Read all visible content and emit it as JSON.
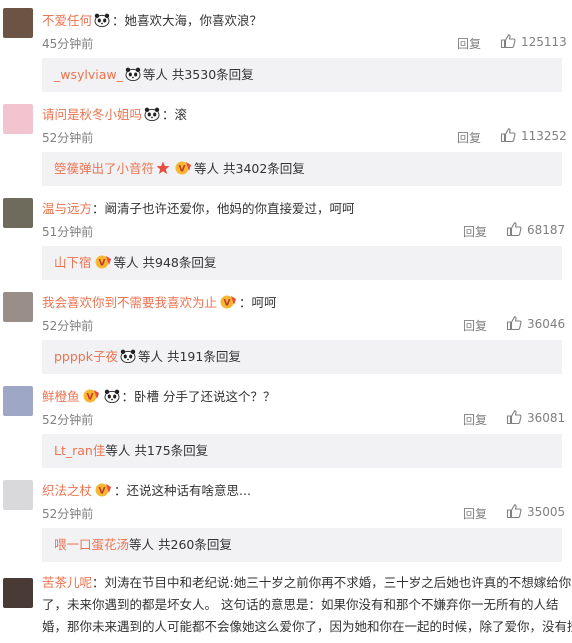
{
  "comments": [
    {
      "user": "不爱任何",
      "text": "：她喜欢大海，你喜欢浪？",
      "time": "45分钟前",
      "reply_label": "回复",
      "likes": "125113",
      "avatar_color": "#6b5444",
      "reply_summary": {
        "name": "_wsylviaw_",
        "text": "等人 共3530条回复"
      }
    },
    {
      "user": "请问是秋冬小姐吗",
      "text": "：滚",
      "time": "52分钟前",
      "reply_label": "回复",
      "likes": "113252",
      "avatar_color": "#f2c4cf",
      "reply_summary": {
        "name": "箜篌弹出了小音符",
        "text": "等人 共3402条回复"
      }
    },
    {
      "user": "温与远方",
      "text": "：阚清子也许还爱你，他妈的你直接爱过，呵呵",
      "time": "51分钟前",
      "reply_label": "回复",
      "likes": "68187",
      "avatar_color": "#6e6a5c",
      "reply_summary": {
        "name": "山下宿",
        "text": "等人 共948条回复"
      }
    },
    {
      "user": "我会喜欢你到不需要我喜欢为止",
      "text": "：呵呵",
      "time": "52分钟前",
      "reply_label": "回复",
      "likes": "36046",
      "avatar_color": "#9a8f88",
      "reply_summary": {
        "name": "ppppk子夜",
        "text": "等人 共191条回复"
      }
    },
    {
      "user": "鲜橙鱼",
      "text": "：卧槽 分手了还说这个？？",
      "time": "52分钟前",
      "reply_label": "回复",
      "likes": "36081",
      "avatar_color": "#9fa7c6",
      "reply_summary": {
        "name": "Lt_ran佳",
        "text": "等人 共175条回复"
      }
    },
    {
      "user": "织法之杖",
      "text": "：还说这种话有啥意思...",
      "time": "52分钟前",
      "reply_label": "回复",
      "likes": "35005",
      "avatar_color": "#d9d9dc",
      "reply_summary": {
        "name": "喂一口蛋花汤",
        "text": "等人 共260条回复"
      }
    }
  ],
  "last_comment": {
    "user": "苦茶儿呢",
    "lines": [
      "：刘涛在节目中和老纪说:她三十岁之前你再不求婚，三十岁之后她也许真的不想嫁给你",
      "了，未来你遇到的都是坏女人。   这句话的意思是：如果你没有和那个不嫌弃你一无所有的人结",
      "婚，那你未来遇到的人可能都不会像她这么爱你了，因为她和你在一起的时候，除了爱你，没有捞"
    ],
    "avatar_color": "#4a3a36"
  },
  "colors": {
    "link": "#eb7350",
    "muted": "#808080",
    "reply_bg": "#f2f2f5"
  }
}
